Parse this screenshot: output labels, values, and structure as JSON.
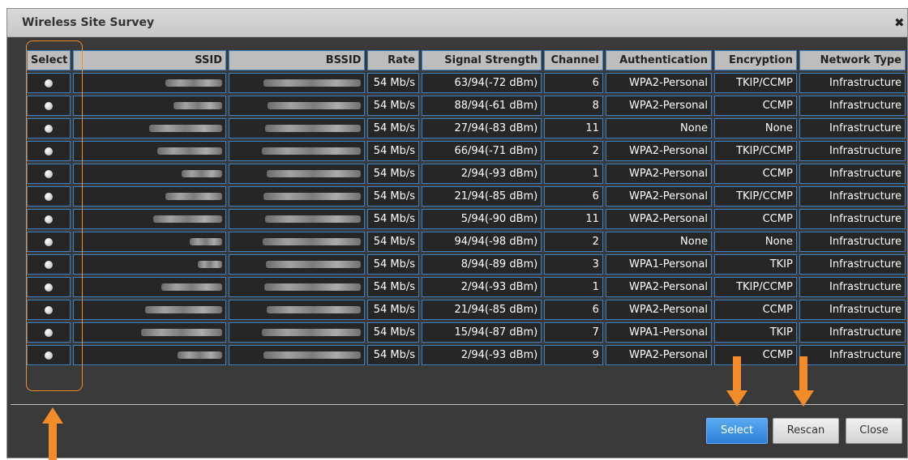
{
  "dialog": {
    "title": "Wireless Site Survey",
    "close_icon": "close-x-icon"
  },
  "table": {
    "headers": [
      "Select",
      "SSID",
      "BSSID",
      "Rate",
      "Signal Strength",
      "Channel",
      "Authentication",
      "Encryption",
      "Network Type"
    ],
    "rows": [
      {
        "rate": "54 Mb/s",
        "signal": "63/94(-72 dBm)",
        "channel": "6",
        "auth": "WPA2-Personal",
        "enc": "TKIP/CCMP",
        "type": "Infrastructure"
      },
      {
        "rate": "54 Mb/s",
        "signal": "88/94(-61 dBm)",
        "channel": "8",
        "auth": "WPA2-Personal",
        "enc": "CCMP",
        "type": "Infrastructure"
      },
      {
        "rate": "54 Mb/s",
        "signal": "27/94(-83 dBm)",
        "channel": "11",
        "auth": "None",
        "enc": "None",
        "type": "Infrastructure"
      },
      {
        "rate": "54 Mb/s",
        "signal": "66/94(-71 dBm)",
        "channel": "2",
        "auth": "WPA2-Personal",
        "enc": "TKIP/CCMP",
        "type": "Infrastructure"
      },
      {
        "rate": "54 Mb/s",
        "signal": "2/94(-93 dBm)",
        "channel": "1",
        "auth": "WPA2-Personal",
        "enc": "CCMP",
        "type": "Infrastructure"
      },
      {
        "rate": "54 Mb/s",
        "signal": "21/94(-85 dBm)",
        "channel": "6",
        "auth": "WPA2-Personal",
        "enc": "TKIP/CCMP",
        "type": "Infrastructure"
      },
      {
        "rate": "54 Mb/s",
        "signal": "5/94(-90 dBm)",
        "channel": "11",
        "auth": "WPA2-Personal",
        "enc": "CCMP",
        "type": "Infrastructure"
      },
      {
        "rate": "54 Mb/s",
        "signal": "94/94(-98 dBm)",
        "channel": "2",
        "auth": "None",
        "enc": "None",
        "type": "Infrastructure"
      },
      {
        "rate": "54 Mb/s",
        "signal": "8/94(-89 dBm)",
        "channel": "3",
        "auth": "WPA1-Personal",
        "enc": "TKIP",
        "type": "Infrastructure"
      },
      {
        "rate": "54 Mb/s",
        "signal": "2/94(-93 dBm)",
        "channel": "1",
        "auth": "WPA2-Personal",
        "enc": "TKIP/CCMP",
        "type": "Infrastructure"
      },
      {
        "rate": "54 Mb/s",
        "signal": "21/94(-85 dBm)",
        "channel": "6",
        "auth": "WPA2-Personal",
        "enc": "CCMP",
        "type": "Infrastructure"
      },
      {
        "rate": "54 Mb/s",
        "signal": "15/94(-87 dBm)",
        "channel": "7",
        "auth": "WPA1-Personal",
        "enc": "TKIP",
        "type": "Infrastructure"
      },
      {
        "rate": "54 Mb/s",
        "signal": "2/94(-93 dBm)",
        "channel": "9",
        "auth": "WPA2-Personal",
        "enc": "CCMP",
        "type": "Infrastructure"
      }
    ]
  },
  "buttons": {
    "select_label": "Select",
    "rescan_label": "Rescan",
    "close_label": "Close"
  },
  "colors": {
    "highlight": "#f28c28",
    "primary_button": "#2a7fd6",
    "cell_border": "#3b7fc4"
  }
}
